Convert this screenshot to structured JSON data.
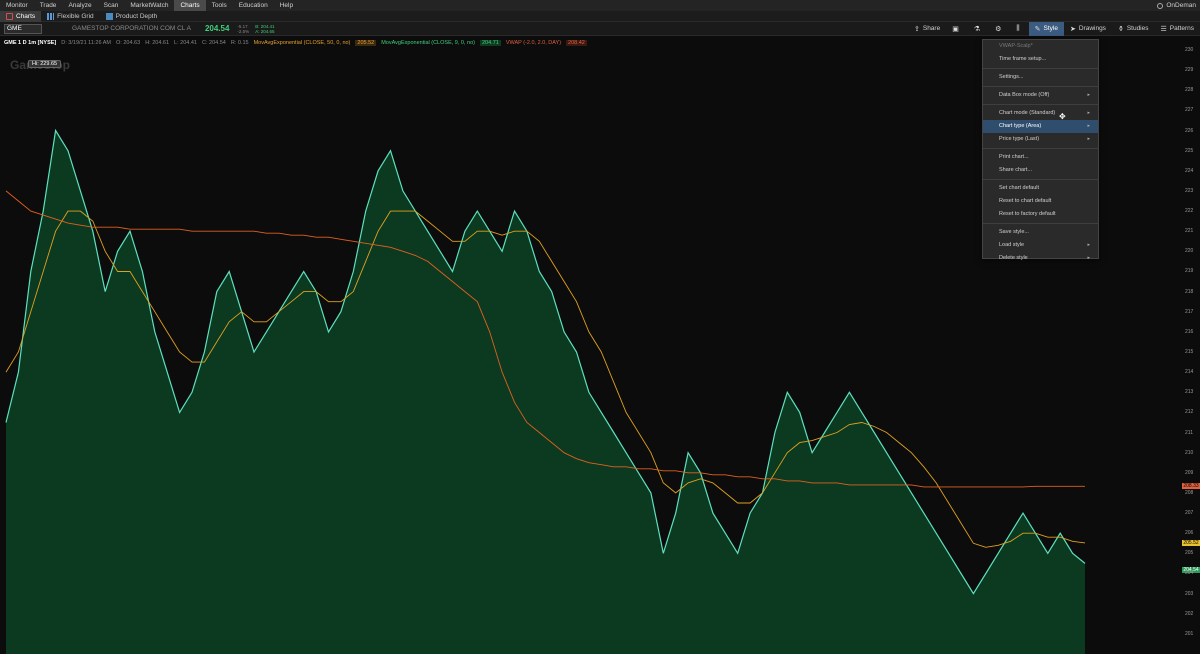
{
  "menu": {
    "items": [
      "Monitor",
      "Trade",
      "Analyze",
      "Scan",
      "MarketWatch",
      "Charts",
      "Tools",
      "Education",
      "Help"
    ],
    "active": "Charts",
    "right_label": "OnDeman"
  },
  "subtabs": [
    {
      "label": "Charts",
      "icon": "chart-icon",
      "active": true
    },
    {
      "label": "Flexible Grid",
      "icon": "grid-icon",
      "active": false
    },
    {
      "label": "Product Depth",
      "icon": "depth-icon",
      "active": false
    }
  ],
  "toolbar": {
    "symbol": "GME",
    "company": "GAMESTOP CORPORATION COM CL A",
    "last_price": "204.54",
    "change_top": "-5.17",
    "change_bottom": "-2.5%",
    "bid": "B: 204.41",
    "ask": "A: 204.65",
    "buttons": [
      {
        "label": "Share",
        "icon": "share-icon"
      },
      {
        "label": "",
        "icon": "layout-icon"
      },
      {
        "label": "",
        "icon": "beaker-icon"
      },
      {
        "label": "",
        "icon": "gear-icon"
      },
      {
        "label": "",
        "icon": "bars-icon"
      },
      {
        "label": "Style",
        "icon": "style-icon",
        "active": true
      },
      {
        "label": "Drawings",
        "icon": "cursor-icon"
      },
      {
        "label": "Studies",
        "icon": "flask-icon"
      },
      {
        "label": "Patterns",
        "icon": "pattern-icon"
      }
    ]
  },
  "studies": {
    "title": "GME 1 D 1m [NYSE]",
    "ohlc": [
      "D: 3/19/21 11:26 AM",
      "O: 204.63",
      "H: 204.61",
      "L: 204.41",
      "C: 204.54",
      "R: 0.15"
    ],
    "ema50_label": "MovAvgExponential (CLOSE, 50, 0, no)",
    "ema50_value": "205.52",
    "ema9_label": "MovAvgExponential (CLOSE, 9, 0, no)",
    "ema9_value": "204.71",
    "vwap_label": "VWAP (-2.0, 2.0, DAY)",
    "vwap_value": "208.42"
  },
  "watermark": "GameStop",
  "hi_label": "Hi: 229.65",
  "price_tags": {
    "vwap": "208.33",
    "ema50": "205.52",
    "last": "204.54"
  },
  "style_menu": {
    "items": [
      {
        "label": "VWAP-Scalp*",
        "disabled": true
      },
      {
        "label": "Time frame setup..."
      },
      {
        "sep": true
      },
      {
        "label": "Settings..."
      },
      {
        "sep": true
      },
      {
        "label": "Data Box mode (Off)",
        "submenu": true
      },
      {
        "sep": true
      },
      {
        "label": "Chart mode (Standard)",
        "submenu": true
      },
      {
        "label": "Chart type (Area)",
        "submenu": true,
        "highlight": true
      },
      {
        "label": "Price type (Last)",
        "submenu": true
      },
      {
        "sep": true
      },
      {
        "label": "Print chart..."
      },
      {
        "label": "Share chart..."
      },
      {
        "sep": true
      },
      {
        "label": "Set chart default"
      },
      {
        "label": "Reset to chart default"
      },
      {
        "label": "Reset to factory default"
      },
      {
        "sep": true
      },
      {
        "label": "Save style..."
      },
      {
        "label": "Load style",
        "submenu": true
      },
      {
        "label": "Delete style",
        "submenu": true
      }
    ]
  },
  "chart_data": {
    "type": "area",
    "title": "GME 1 D 1m [NYSE]",
    "xlabel": "",
    "ylabel": "",
    "ylim": [
      200,
      230
    ],
    "y_ticks": [
      201,
      202,
      203,
      204,
      205,
      206,
      207,
      208,
      209,
      210,
      211,
      212,
      213,
      214,
      215,
      216,
      217,
      218,
      219,
      220,
      221,
      222,
      223,
      224,
      225,
      226,
      227,
      228,
      229,
      230
    ],
    "colors": {
      "area_fill": "#0b3a20",
      "price": "#5ee0c0",
      "ema9": "#e0a020",
      "ema50": "#e06020"
    },
    "series": [
      {
        "name": "Close",
        "values": [
          211.5,
          214,
          219,
          222,
          226,
          225,
          223,
          221,
          218,
          220,
          221,
          219,
          216,
          214,
          212,
          213,
          215,
          218,
          219,
          217,
          215,
          216,
          217,
          218,
          219,
          218,
          216,
          217,
          219,
          222,
          224,
          225,
          223,
          222,
          221,
          220,
          219,
          221,
          222,
          221,
          220,
          222,
          221,
          219,
          218,
          216,
          215,
          213,
          212,
          211,
          210,
          209,
          208,
          205,
          207,
          210,
          209,
          207,
          206,
          205,
          207,
          208,
          211,
          213,
          212,
          210,
          211,
          212,
          213,
          212,
          211,
          210,
          209,
          208,
          207,
          206,
          205,
          204,
          203,
          204,
          205,
          206,
          207,
          206,
          205,
          206,
          205,
          204.5
        ]
      },
      {
        "name": "MovAvgExponential (CLOSE, 9, 0, no)",
        "values": [
          214,
          215,
          217,
          219,
          221,
          222,
          222,
          221.5,
          220,
          219,
          219,
          218,
          217,
          216,
          215,
          214.5,
          214.5,
          215.5,
          216.5,
          217,
          216.5,
          216.5,
          217,
          217.5,
          218,
          218,
          217.5,
          217.5,
          218,
          219.5,
          221,
          222,
          222,
          222,
          221.5,
          221,
          220.5,
          220.5,
          221,
          221,
          220.8,
          221,
          221,
          220.5,
          219.5,
          218.5,
          217.5,
          216,
          215,
          213.5,
          212,
          211,
          210,
          208.5,
          208,
          208.5,
          208.7,
          208.5,
          208,
          207.5,
          207.5,
          208,
          209,
          210,
          210.5,
          210.6,
          210.8,
          211,
          211.4,
          211.5,
          211.3,
          211,
          210.5,
          210,
          209.3,
          208.5,
          207.5,
          206.5,
          205.5,
          205.3,
          205.4,
          205.6,
          206,
          206,
          205.8,
          205.8,
          205.6,
          205.52
        ]
      },
      {
        "name": "VWAP (-2.0, 2.0, DAY)",
        "values": [
          223,
          222.5,
          222,
          221.8,
          221.6,
          221.4,
          221.3,
          221.2,
          221.2,
          221.2,
          221.1,
          221.1,
          221.1,
          221.1,
          221.1,
          221,
          221,
          221,
          221,
          221,
          221,
          220.9,
          220.9,
          220.8,
          220.8,
          220.7,
          220.7,
          220.6,
          220.5,
          220.4,
          220.3,
          220.2,
          220,
          219.8,
          219.5,
          219,
          218.5,
          218,
          217.5,
          216,
          214,
          212.5,
          211.5,
          211,
          210.5,
          210,
          209.7,
          209.5,
          209.4,
          209.3,
          209.3,
          209.2,
          209.2,
          209.1,
          209.1,
          209,
          209,
          208.9,
          208.9,
          208.8,
          208.8,
          208.7,
          208.7,
          208.6,
          208.6,
          208.5,
          208.5,
          208.5,
          208.4,
          208.4,
          208.4,
          208.4,
          208.4,
          208.4,
          208.3,
          208.3,
          208.3,
          208.3,
          208.3,
          208.3,
          208.3,
          208.3,
          208.3,
          208.33,
          208.33,
          208.33,
          208.33,
          208.33
        ]
      }
    ]
  }
}
